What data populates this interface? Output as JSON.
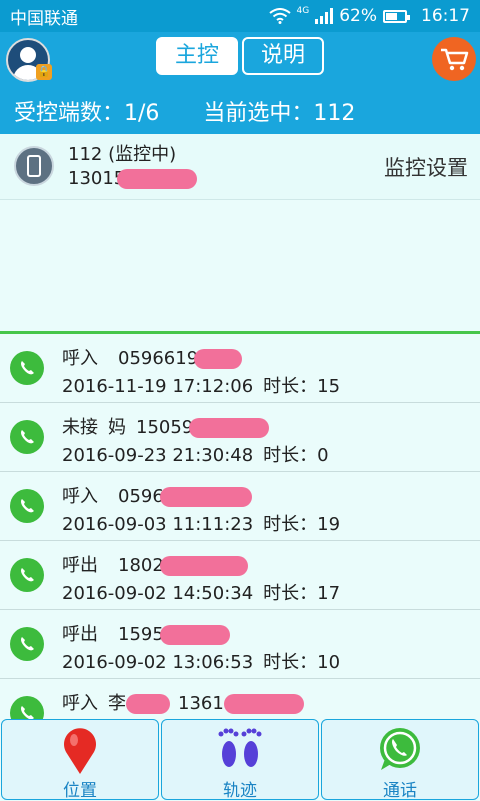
{
  "status_bar": {
    "carrier": "中国联通",
    "network": "4G",
    "battery_percent": "62%",
    "battery_level": 0.62,
    "time": "16:17"
  },
  "header": {
    "tabs": [
      {
        "label": "主控",
        "active": true
      },
      {
        "label": "说明",
        "active": false
      }
    ],
    "avatar_icon": "user-lock-icon",
    "cart_icon": "shopping-cart-icon"
  },
  "info": {
    "count_text": "受控端数：1/6",
    "selected_text": "当前选中：112"
  },
  "device": {
    "name": "112 (监控中)",
    "number_visible": "13015",
    "settings_label": "监控设置"
  },
  "calls": [
    {
      "type": "呼入",
      "contact": "",
      "number_visible": "0596619",
      "datetime": "2016-11-19 17:12:06",
      "duration": "时长：15"
    },
    {
      "type": "未接",
      "contact": "妈",
      "number_visible": "15059",
      "datetime": "2016-09-23 21:30:48",
      "duration": "时长：0"
    },
    {
      "type": "呼入",
      "contact": "",
      "number_visible": "0596",
      "datetime": "2016-09-03 11:11:23",
      "duration": "时长：19"
    },
    {
      "type": "呼出",
      "contact": "",
      "number_visible": "1802",
      "datetime": "2016-09-02 14:50:34",
      "duration": "时长：17"
    },
    {
      "type": "呼出",
      "contact": "",
      "number_visible": "1595",
      "datetime": "2016-09-02 13:06:53",
      "duration": "时长：10"
    },
    {
      "type": "呼入",
      "contact": "李",
      "number_visible": "1361",
      "datetime": "",
      "duration": ""
    }
  ],
  "bottom_nav": [
    {
      "label": "位置",
      "icon": "map-pin-icon"
    },
    {
      "label": "轨迹",
      "icon": "footprints-icon"
    },
    {
      "label": "通话",
      "icon": "phone-call-icon"
    }
  ],
  "colors": {
    "header_blue": "#1aa6dd",
    "accent_green": "#46c64a",
    "cart_orange": "#f06522",
    "redaction_pink": "#f2709a"
  }
}
